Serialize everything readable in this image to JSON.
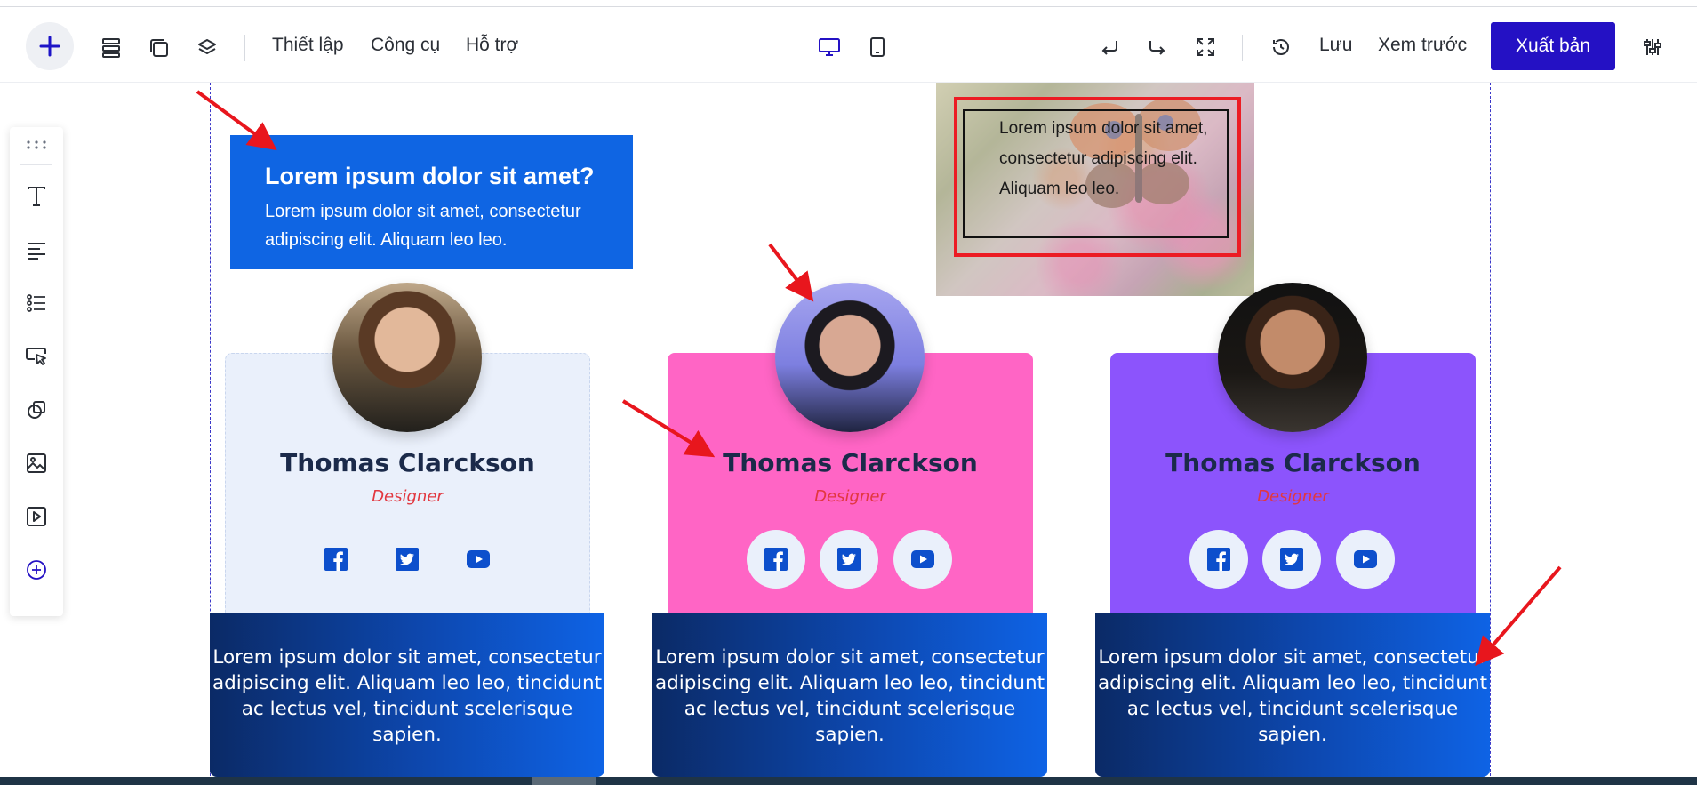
{
  "toolbar": {
    "menu_settings": "Thiết lập",
    "menu_tools": "Công cụ",
    "menu_support": "Hỗ trợ",
    "save": "Lưu",
    "preview": "Xem trước",
    "publish": "Xuất bản",
    "accent_color": "#2411c4"
  },
  "promo": {
    "title": "Lorem ipsum dolor sit amet?",
    "body": "Lorem ipsum dolor sit amet, consectetur adipiscing elit. Aliquam leo leo."
  },
  "image_box": {
    "text": "Lorem ipsum dolor sit amet, consectetur adipiscing elit. Aliquam leo leo."
  },
  "team": [
    {
      "name": "Thomas Clarckson",
      "role": "Designer",
      "quote": "Lorem ipsum dolor sit amet, consectetur adipiscing elit. Aliquam leo leo, tincidunt ac lectus vel, tincidunt scelerisque sapien.",
      "card_color": "#eaf0fb"
    },
    {
      "name": "Thomas Clarckson",
      "role": "Designer",
      "quote": "Lorem ipsum dolor sit amet, consectetur adipiscing elit. Aliquam leo leo, tincidunt ac lectus vel, tincidunt scelerisque sapien.",
      "card_color": "#ff65c5"
    },
    {
      "name": "Thomas Clarckson",
      "role": "Designer",
      "quote": "Lorem ipsum dolor sit amet, consectetur adipiscing elit. Aliquam leo leo, tincidunt ac lectus vel, tincidunt scelerisque sapien.",
      "card_color": "#8c54fc"
    }
  ],
  "icons": {
    "sidebar": [
      "drag-handle-icon",
      "text-icon",
      "paragraph-icon",
      "list-icon",
      "button-cursor-icon",
      "shape-icon",
      "image-icon",
      "video-icon",
      "add-circle-icon"
    ],
    "social": [
      "facebook-icon",
      "twitter-icon",
      "youtube-icon"
    ]
  }
}
